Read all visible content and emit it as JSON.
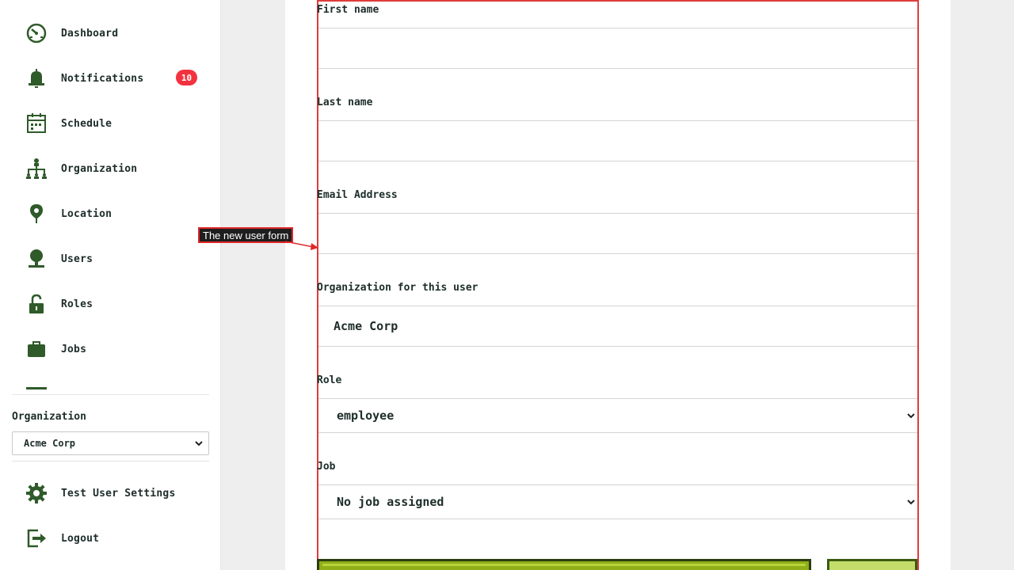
{
  "sidebar": {
    "nav": [
      {
        "label": "Dashboard",
        "icon": "dashboard-icon"
      },
      {
        "label": "Notifications",
        "icon": "bell-icon",
        "badge": "10"
      },
      {
        "label": "Schedule",
        "icon": "calendar-icon"
      },
      {
        "label": "Organization",
        "icon": "org-chart-icon"
      },
      {
        "label": "Location",
        "icon": "location-pin-icon"
      },
      {
        "label": "Users",
        "icon": "user-icon"
      },
      {
        "label": "Roles",
        "icon": "unlock-icon"
      },
      {
        "label": "Jobs",
        "icon": "briefcase-icon"
      }
    ],
    "organization": {
      "label": "Organization",
      "selected": "Acme Corp"
    },
    "bottom_nav": [
      {
        "label": "Test User Settings",
        "icon": "gear-icon"
      },
      {
        "label": "Logout",
        "icon": "logout-icon"
      }
    ]
  },
  "form": {
    "first_name": {
      "label": "First name",
      "value": ""
    },
    "last_name": {
      "label": "Last name",
      "value": ""
    },
    "email": {
      "label": "Email Address",
      "value": ""
    },
    "organization": {
      "label": "Organization for this user",
      "value": "Acme Corp"
    },
    "role": {
      "label": "Role",
      "selected": "employee"
    },
    "job": {
      "label": "Job",
      "selected": "No job assigned"
    }
  },
  "annotation": {
    "text": "The new user form"
  },
  "colors": {
    "accent_green": "#2f5a2a",
    "badge_red": "#f2323f",
    "annotation_red": "#e03b3b",
    "primary_button": "#8fae18",
    "secondary_button": "#c4dd6a"
  }
}
